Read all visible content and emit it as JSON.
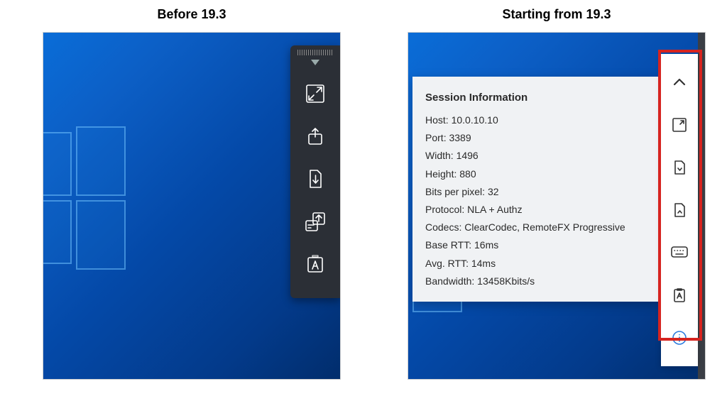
{
  "labels": {
    "left_title": "Before 19.3",
    "right_title": "Starting from 19.3"
  },
  "old_toolbar": {
    "items": [
      {
        "name": "fullscreen-button"
      },
      {
        "name": "upload-button"
      },
      {
        "name": "download-button"
      },
      {
        "name": "paste-button"
      },
      {
        "name": "text-input-button"
      }
    ]
  },
  "new_toolbar": {
    "items": [
      {
        "name": "collapse-button"
      },
      {
        "name": "fullscreen-button"
      },
      {
        "name": "download-button"
      },
      {
        "name": "upload-button"
      },
      {
        "name": "keyboard-button"
      },
      {
        "name": "text-input-button"
      },
      {
        "name": "session-info-button"
      }
    ]
  },
  "session_info": {
    "title": "Session Information",
    "rows": [
      {
        "label": "Host",
        "value": "10.0.10.10"
      },
      {
        "label": "Port",
        "value": "3389"
      },
      {
        "label": "Width",
        "value": "1496"
      },
      {
        "label": "Height",
        "value": "880"
      },
      {
        "label": "Bits per pixel",
        "value": "32"
      },
      {
        "label": "Protocol",
        "value": "NLA + Authz"
      },
      {
        "label": "Codecs",
        "value": "ClearCodec, RemoteFX Progressive"
      },
      {
        "label": "Base RTT",
        "value": "16ms"
      },
      {
        "label": "Avg. RTT",
        "value": "14ms"
      },
      {
        "label": "Bandwidth",
        "value": "13458Kbits/s"
      }
    ]
  }
}
